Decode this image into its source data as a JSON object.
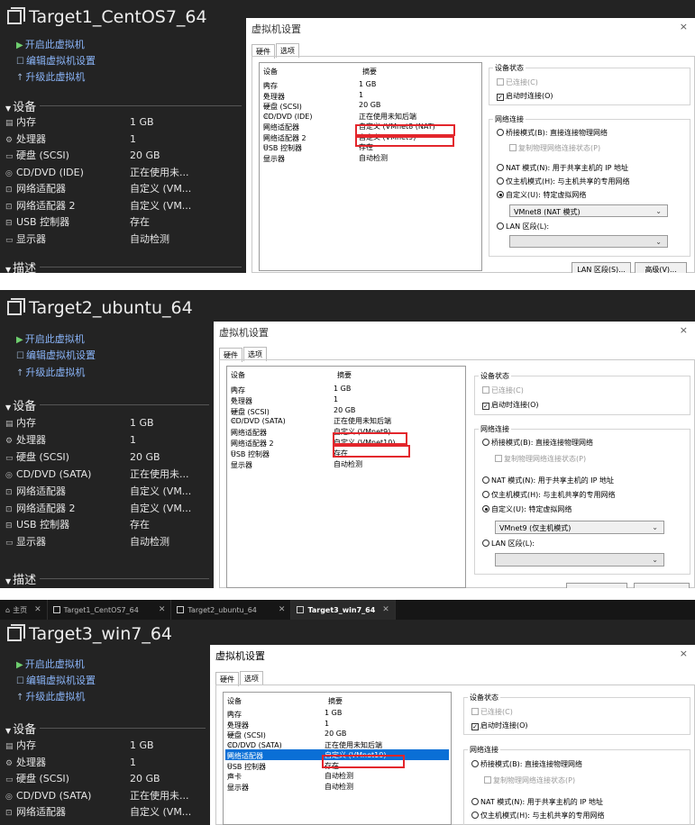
{
  "actions": {
    "power_on": "开启此虚拟机",
    "edit": "编辑虚拟机设置",
    "upgrade": "升级此虚拟机"
  },
  "sections": {
    "devices": "设备",
    "description": "描述"
  },
  "dialog_common": {
    "title": "虚拟机设置",
    "close": "×",
    "tab_hardware": "硬件",
    "tab_options": "选项",
    "col_device": "设备",
    "col_summary": "摘要",
    "device_status": "设备状态",
    "connected": "已连接(C)",
    "connect_on_power": "启动时连接(O)",
    "network_connection": "网络连接",
    "bridged": "桥接模式(B): 直接连接物理网络",
    "replicate": "复制物理网络连接状态(P)",
    "nat": "NAT 模式(N): 用于共享主机的 IP 地址",
    "hostonly": "仅主机模式(H): 与主机共享的专用网络",
    "custom": "自定义(U): 特定虚拟网络",
    "lan": "LAN 区段(L):",
    "lan_btn": "LAN 区段(S)...",
    "adv_btn": "高级(V)..."
  },
  "tabs": [
    {
      "label": "主页",
      "active": false
    },
    {
      "label": "Target1_CentOS7_64",
      "active": false
    },
    {
      "label": "Target2_ubuntu_64",
      "active": false
    },
    {
      "label": "Target3_win7_64",
      "active": true
    }
  ],
  "vm1": {
    "name": "Target1_CentOS7_64",
    "devices": [
      {
        "name": "内存",
        "value": "1 GB"
      },
      {
        "name": "处理器",
        "value": "1"
      },
      {
        "name": "硬盘 (SCSI)",
        "value": "20 GB"
      },
      {
        "name": "CD/DVD (IDE)",
        "value": "正在使用未..."
      },
      {
        "name": "网络适配器",
        "value": "自定义 (VM..."
      },
      {
        "name": "网络适配器 2",
        "value": "自定义 (VM..."
      },
      {
        "name": "USB 控制器",
        "value": "存在"
      },
      {
        "name": "显示器",
        "value": "自动检测"
      }
    ],
    "hw": [
      {
        "name": "内存",
        "summary": "1 GB"
      },
      {
        "name": "处理器",
        "summary": "1"
      },
      {
        "name": "硬盘 (SCSI)",
        "summary": "20 GB"
      },
      {
        "name": "CD/DVD (IDE)",
        "summary": "正在使用未知后端"
      },
      {
        "name": "网络适配器",
        "summary": "自定义 (VMnet8 (NAT)"
      },
      {
        "name": "网络适配器 2",
        "summary": "自定义 (VMnet9)"
      },
      {
        "name": "USB 控制器",
        "summary": "存在"
      },
      {
        "name": "显示器",
        "summary": "自动检测"
      }
    ],
    "vmnet": "VMnet8 (NAT 模式)"
  },
  "vm2": {
    "name": "Target2_ubuntu_64",
    "devices": [
      {
        "name": "内存",
        "value": "1 GB"
      },
      {
        "name": "处理器",
        "value": "1"
      },
      {
        "name": "硬盘 (SCSI)",
        "value": "20 GB"
      },
      {
        "name": "CD/DVD (SATA)",
        "value": "正在使用未..."
      },
      {
        "name": "网络适配器",
        "value": "自定义 (VM..."
      },
      {
        "name": "网络适配器 2",
        "value": "自定义 (VM..."
      },
      {
        "name": "USB 控制器",
        "value": "存在"
      },
      {
        "name": "显示器",
        "value": "自动检测"
      }
    ],
    "hw": [
      {
        "name": "内存",
        "summary": "1 GB"
      },
      {
        "name": "处理器",
        "summary": "1"
      },
      {
        "name": "硬盘 (SCSI)",
        "summary": "20 GB"
      },
      {
        "name": "CD/DVD (SATA)",
        "summary": "正在使用未知后端"
      },
      {
        "name": "网络适配器",
        "summary": "自定义 (VMnet9)"
      },
      {
        "name": "网络适配器 2",
        "summary": "自定义 (VMnet10)"
      },
      {
        "name": "USB 控制器",
        "summary": "存在"
      },
      {
        "name": "显示器",
        "summary": "自动检测"
      }
    ],
    "vmnet": "VMnet9 (仅主机模式)"
  },
  "vm3": {
    "name": "Target3_win7_64",
    "devices": [
      {
        "name": "内存",
        "value": "1 GB"
      },
      {
        "name": "处理器",
        "value": "1"
      },
      {
        "name": "硬盘 (SCSI)",
        "value": "20 GB"
      },
      {
        "name": "CD/DVD (SATA)",
        "value": "正在使用未..."
      },
      {
        "name": "网络适配器",
        "value": "自定义 (VM..."
      }
    ],
    "hw": [
      {
        "name": "内存",
        "summary": "1 GB"
      },
      {
        "name": "处理器",
        "summary": "1"
      },
      {
        "name": "硬盘 (SCSI)",
        "summary": "20 GB"
      },
      {
        "name": "CD/DVD (SATA)",
        "summary": "正在使用未知后端"
      },
      {
        "name": "网络适配器",
        "summary": "自定义 (VMnet10)"
      },
      {
        "name": "USB 控制器",
        "summary": "存在"
      },
      {
        "name": "声卡",
        "summary": "自动检测"
      },
      {
        "name": "显示器",
        "summary": "自动检测"
      }
    ]
  }
}
